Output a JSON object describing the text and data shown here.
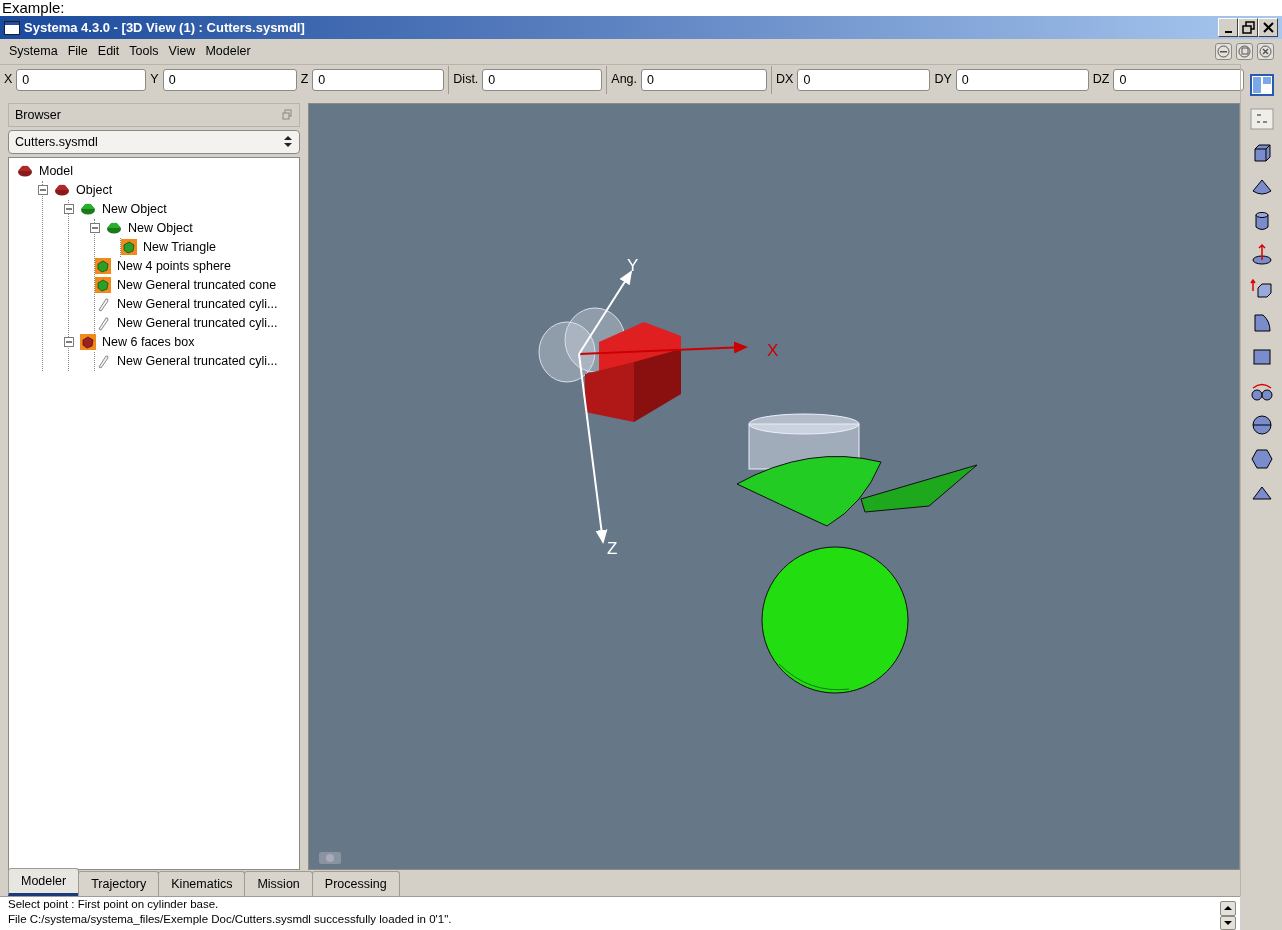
{
  "caption": "Example:",
  "window": {
    "title": "Systema 4.3.0 - [3D View (1) : Cutters.sysmdl]"
  },
  "menu": [
    "Systema",
    "File",
    "Edit",
    "Tools",
    "View",
    "Modeler"
  ],
  "coordinate_groups": [
    [
      {
        "label": "X",
        "value": "0"
      },
      {
        "label": "Y",
        "value": "0"
      },
      {
        "label": "Z",
        "value": "0"
      }
    ],
    [
      {
        "label": "Dist.",
        "value": "0"
      }
    ],
    [
      {
        "label": "Ang.",
        "value": "0"
      }
    ],
    [
      {
        "label": "DX",
        "value": "0"
      },
      {
        "label": "DY",
        "value": "0"
      },
      {
        "label": "DZ",
        "value": "0"
      }
    ]
  ],
  "browser": {
    "title": "Browser",
    "file": "Cutters.sysmdl",
    "tree": [
      {
        "label": "Model",
        "kind": "red-folder",
        "children": [
          {
            "label": "Object",
            "kind": "red-folder",
            "expanded": true,
            "children": [
              {
                "label": "New Object",
                "kind": "green-folder",
                "expanded": true,
                "children": [
                  {
                    "label": "New Object",
                    "kind": "green-folder",
                    "expanded": true,
                    "children": [
                      {
                        "label": "New Triangle",
                        "kind": "green-solid"
                      }
                    ]
                  },
                  {
                    "label": "New 4 points sphere",
                    "kind": "green-solid"
                  },
                  {
                    "label": "New General truncated cone",
                    "kind": "green-solid"
                  },
                  {
                    "label": "New General truncated cyli...",
                    "kind": "pencil"
                  },
                  {
                    "label": "New General truncated cyli...",
                    "kind": "pencil"
                  }
                ]
              },
              {
                "label": "New 6 faces box",
                "kind": "red-solid",
                "expanded": true,
                "children": [
                  {
                    "label": "New General truncated cyli...",
                    "kind": "pencil"
                  }
                ]
              }
            ]
          }
        ]
      }
    ]
  },
  "viewport": {
    "axes": [
      {
        "label": "X"
      },
      {
        "label": "Y"
      },
      {
        "label": "Z"
      }
    ]
  },
  "tabs": [
    {
      "label": "Modeler",
      "selected": true
    },
    {
      "label": "Trajectory",
      "selected": false
    },
    {
      "label": "Kinematics",
      "selected": false
    },
    {
      "label": "Mission",
      "selected": false
    },
    {
      "label": "Processing",
      "selected": false
    }
  ],
  "status_lines": [
    "Select point : First point on cylinder base.",
    "File C:/systema/systema_files/Exemple Doc/Cutters.sysmdl successfully loaded in 0'1\"."
  ]
}
